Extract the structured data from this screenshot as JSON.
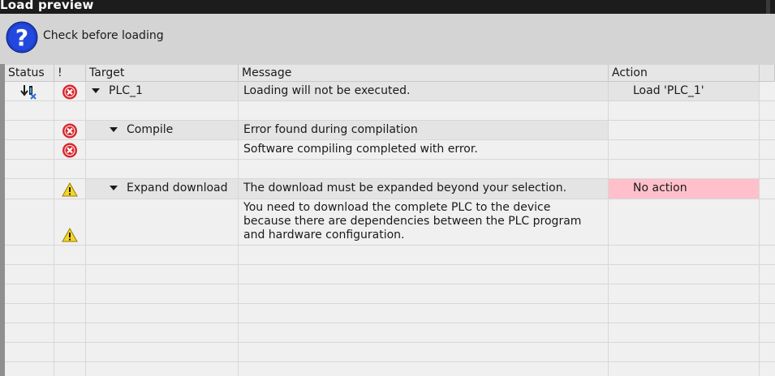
{
  "window": {
    "title": "Load preview"
  },
  "header": {
    "text": "Check before loading",
    "icon": "help-icon"
  },
  "columns": {
    "status": "Status",
    "severity": "!",
    "target": "Target",
    "message": "Message",
    "action": "Action"
  },
  "rows": [
    {
      "severity": "error",
      "target": "PLC_1",
      "expanded": true,
      "message": "Loading will not be executed.",
      "action": "Load 'PLC_1'",
      "status_icon": "download-status-icon"
    },
    {
      "severity": "error",
      "target": "Compile",
      "expanded": true,
      "message": "Error found during compilation",
      "action": ""
    },
    {
      "severity": "error",
      "target": "",
      "message": "Software compiling completed with error.",
      "action": ""
    },
    {
      "severity": "warning",
      "target": "Expand download",
      "expanded": true,
      "message": "The download must be expanded beyond your selection.",
      "action": "No action"
    },
    {
      "severity": "warning",
      "target": "",
      "message": "You need to download the complete PLC to the device because there are dependencies between the PLC program and hardware configuration.",
      "action": ""
    }
  ],
  "colors": {
    "error": "#d8282f",
    "warning": "#f3d626",
    "no_action_bg": "#ffc0cb",
    "help_icon": "#1d3fc9"
  }
}
